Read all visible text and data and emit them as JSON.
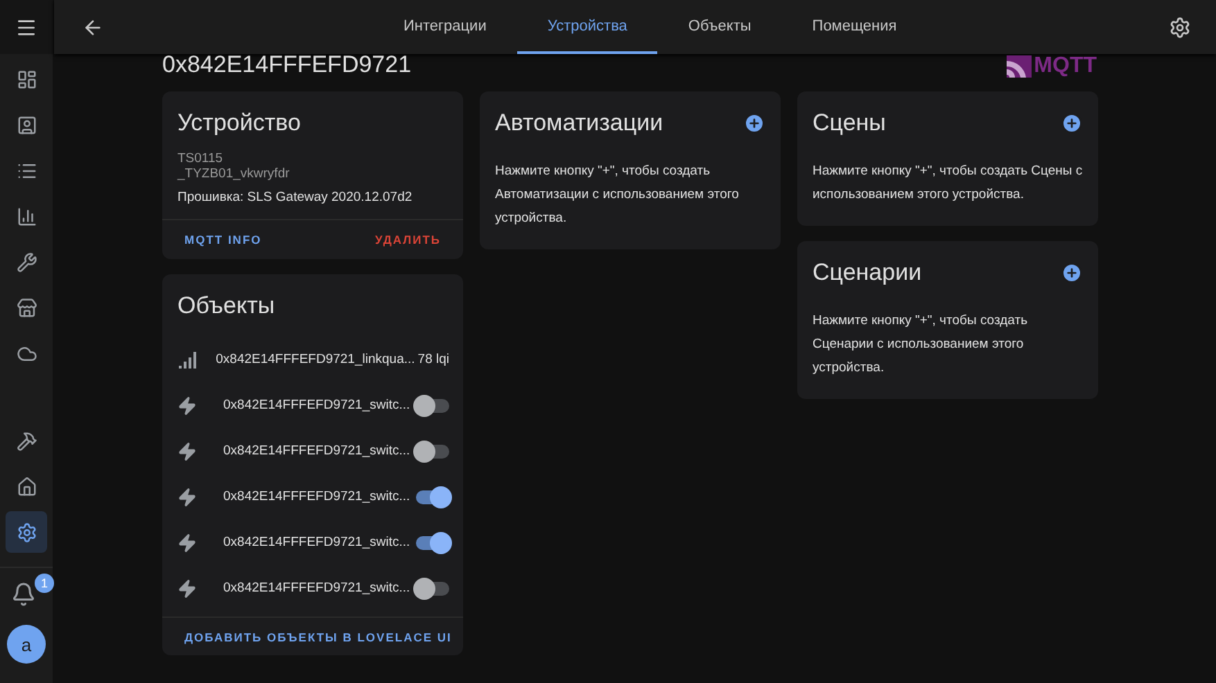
{
  "sidebar": {
    "items": [
      {
        "selected": false
      },
      {
        "selected": false
      },
      {
        "selected": false
      },
      {
        "selected": false
      },
      {
        "selected": false
      },
      {
        "selected": false
      },
      {
        "selected": false
      },
      {
        "selected": false
      },
      {
        "selected": false
      },
      {
        "selected": true
      }
    ],
    "notifications": {
      "badge": "1"
    },
    "avatar": "a"
  },
  "tabs": [
    {
      "label": "Интеграции",
      "selected": false
    },
    {
      "label": "Устройства",
      "selected": true
    },
    {
      "label": "Объекты",
      "selected": false
    },
    {
      "label": "Помещения",
      "selected": false
    }
  ],
  "device_title": "0x842E14FFFEFD9721",
  "logo": "MQTT",
  "device_card": {
    "title": "Устройство",
    "model": "TS0115",
    "manufacturer": "_TYZB01_vkwryfdr",
    "firmware": "Прошивка: SLS Gateway 2020.12.07d2",
    "actions": [
      "MQTT INFO",
      "УДАЛИТЬ"
    ]
  },
  "entities_card": {
    "title": "Объекты",
    "entities": [
      {
        "kind": "sensor",
        "name": "0x842E14FFFEFD9721_linkqua...",
        "state": "78 lqi"
      },
      {
        "kind": "switch",
        "name": "0x842E14FFFEFD9721_switc...",
        "on": false
      },
      {
        "kind": "switch",
        "name": "0x842E14FFFEFD9721_switc...",
        "on": false
      },
      {
        "kind": "switch",
        "name": "0x842E14FFFEFD9721_switc...",
        "on": true
      },
      {
        "kind": "switch",
        "name": "0x842E14FFFEFD9721_switc...",
        "on": true
      },
      {
        "kind": "switch",
        "name": "0x842E14FFFEFD9721_switc...",
        "on": false
      }
    ],
    "action": "ДОБАВИТЬ ОБЪЕКТЫ В LOVELACE UI"
  },
  "automations_card": {
    "title": "Автоматизации",
    "text": "Нажмите кнопку \"+\", чтобы создать Автоматизации с использованием этого устройства."
  },
  "scenes_card": {
    "title": "Сцены",
    "text": "Нажмите кнопку \"+\", чтобы создать Сцены с использованием этого устройства."
  },
  "scripts_card": {
    "title": "Сценарии",
    "text": "Нажмите кнопку \"+\", чтобы создать Сценарии с использованием этого устройства."
  }
}
